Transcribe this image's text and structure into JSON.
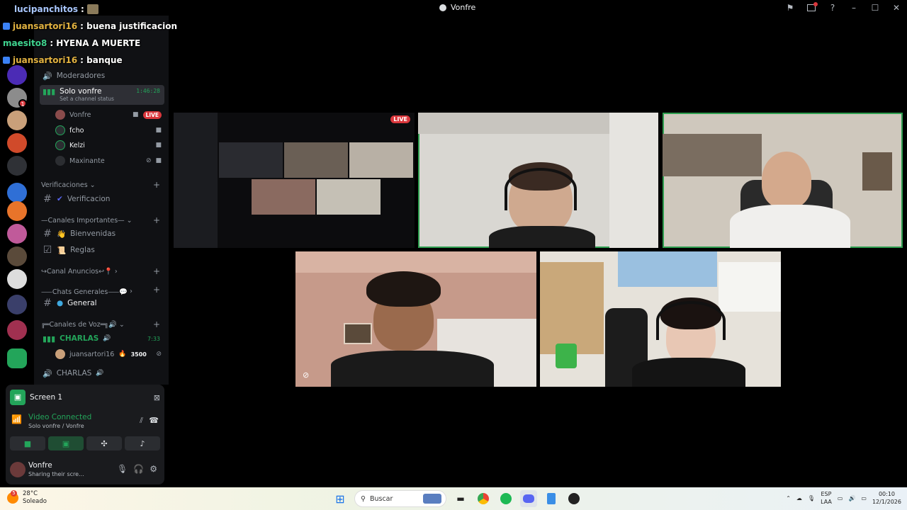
{
  "window": {
    "title": "Vonfre"
  },
  "chat_overlay": [
    {
      "user": "lucipanchitos",
      "message": "",
      "color": "blue"
    },
    {
      "user": "juansartori16",
      "message": ": buena justificacion",
      "color": "gold"
    },
    {
      "user": "maesito8",
      "message": ": HYENA A MUERTE",
      "color": "green"
    },
    {
      "user": "juansartori16",
      "message": ": banque",
      "color": "gold"
    }
  ],
  "chat_user0_suffix": " :",
  "sidebar": {
    "moderadores": "Moderadores",
    "solo_vonfre": {
      "name": "Solo vonfre",
      "status": "Set a channel status",
      "timer": "1:46:28"
    },
    "voice_users": [
      {
        "name": "Vonfre",
        "live": "LIVE"
      },
      {
        "name": "fcho"
      },
      {
        "name": "Kelzi"
      },
      {
        "name": "Maxinante"
      }
    ],
    "cat_verificaciones": "Verificaciones",
    "ch_verificacion": "Verificacion",
    "cat_importantes": "—Canales Importantes—",
    "ch_bienvenidas": "Bienvenidas",
    "ch_reglas": "Reglas",
    "cat_anuncios": "↪Canal Anuncios↩📍",
    "cat_chats": "⸺Chats Generales⸺💬",
    "ch_general": "General",
    "cat_voz": "╔═Canales de Voz═╗🔊",
    "charlas1": {
      "name": "CHARLAS",
      "timer": "7:33"
    },
    "charlas_user": {
      "name": "juansartori16",
      "count": "3500"
    },
    "charlas2": {
      "name": "CHARLAS"
    }
  },
  "voice_panel": {
    "screen_label": "Screen 1",
    "status": "Video Connected",
    "location": "Solo vonfre / Vonfre",
    "user_name": "Vonfre",
    "user_status": "Sharing their scre..."
  },
  "stream_tile": {
    "live": "LIVE"
  },
  "taskbar": {
    "temp": "28°C",
    "weather": "Soleado",
    "weather_badge": "5",
    "search_placeholder": "Buscar",
    "lang1": "ESP",
    "lang2": "LAA",
    "time": "00:10",
    "date": "12/1/2026"
  }
}
